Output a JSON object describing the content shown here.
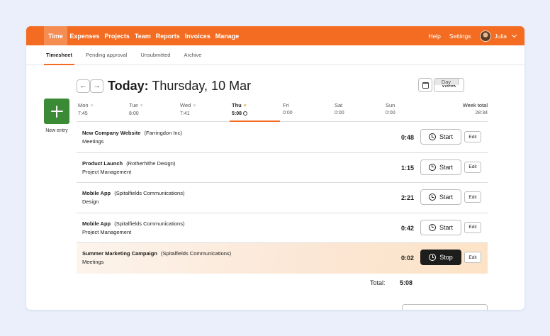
{
  "nav": {
    "items": [
      {
        "label": "Time",
        "active": true
      },
      {
        "label": "Expenses"
      },
      {
        "label": "Projects"
      },
      {
        "label": "Team"
      },
      {
        "label": "Reports"
      },
      {
        "label": "Invoices"
      },
      {
        "label": "Manage"
      }
    ],
    "help": "Help",
    "settings": "Settings",
    "user_name": "Julia"
  },
  "subnav": {
    "items": [
      {
        "label": "Timesheet",
        "active": true
      },
      {
        "label": "Pending approval"
      },
      {
        "label": "Unsubmitted"
      },
      {
        "label": "Archive"
      }
    ]
  },
  "header": {
    "prev_icon": "←",
    "next_icon": "→",
    "title_bold": "Today:",
    "title_rest": "Thursday, 10 Mar",
    "view_day": "Day",
    "view_week": "Week"
  },
  "new_entry_label": "New entry",
  "days": [
    {
      "name": "Mon",
      "value": "7:45"
    },
    {
      "name": "Tue",
      "value": "8:00"
    },
    {
      "name": "Wed",
      "value": "7:41"
    },
    {
      "name": "Thu",
      "value": "5:08",
      "active": true
    },
    {
      "name": "Fri",
      "value": "0:00"
    },
    {
      "name": "Sat",
      "value": "0:00"
    },
    {
      "name": "Sun",
      "value": "0:00"
    }
  ],
  "week_total": {
    "label": "Week total",
    "value": "28:34"
  },
  "entries": [
    {
      "project": "New Company Website",
      "client": "(Farringdon Inc)",
      "task": "Meetings",
      "duration": "0:48",
      "action": "Start",
      "running": false
    },
    {
      "project": "Product Launch",
      "client": "(Rotherhithe Design)",
      "task": "Project Management",
      "duration": "1:15",
      "action": "Start",
      "running": false
    },
    {
      "project": "Mobile App",
      "client": "(Spitalfields Communications)",
      "task": "Design",
      "duration": "2:21",
      "action": "Start",
      "running": false
    },
    {
      "project": "Mobile App",
      "client": "(Spitalfields Communications)",
      "task": "Project Management",
      "duration": "0:42",
      "action": "Start",
      "running": false
    },
    {
      "project": "Summer Marketing Campaign",
      "client": "(Spitalfields Communications)",
      "task": "Meetings",
      "duration": "0:02",
      "action": "Stop",
      "running": true
    }
  ],
  "edit_label": "Edit",
  "total": {
    "label": "Total:",
    "value": "5:08"
  },
  "colors": {
    "brand": "#f36c21",
    "new_entry": "#3a8a36",
    "background": "#eaeffb"
  }
}
